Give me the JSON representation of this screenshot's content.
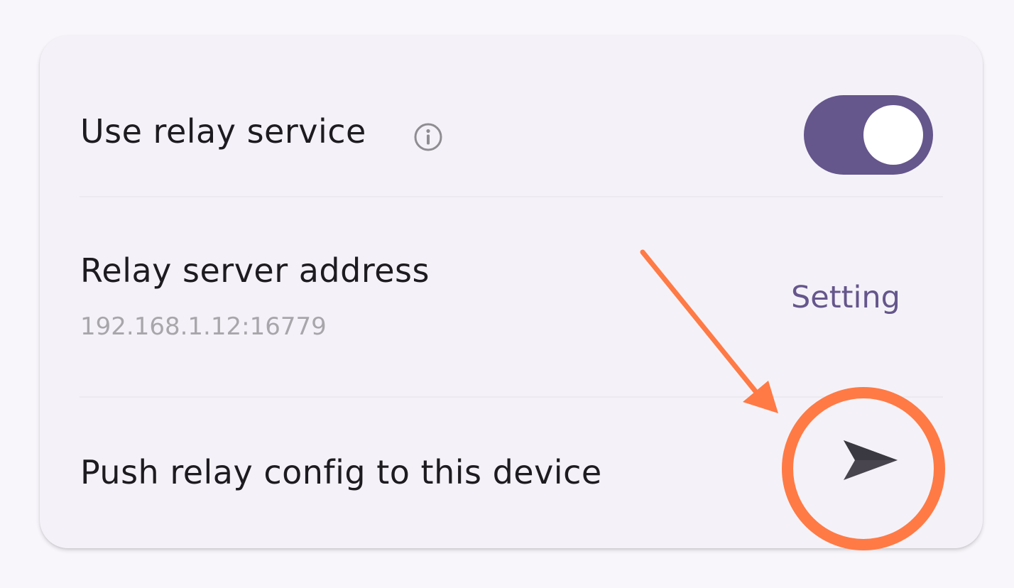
{
  "relay": {
    "use_relay_label": "Use relay service",
    "use_relay_enabled": true,
    "server_address_label": "Relay server address",
    "server_address_value": "192.168.1.12:16779",
    "setting_button_label": "Setting",
    "push_config_label": "Push relay config to this device"
  },
  "icons": {
    "info": "info-icon",
    "send": "send-icon"
  },
  "colors": {
    "accent": "#65568c",
    "annotation": "#ff7a45"
  }
}
